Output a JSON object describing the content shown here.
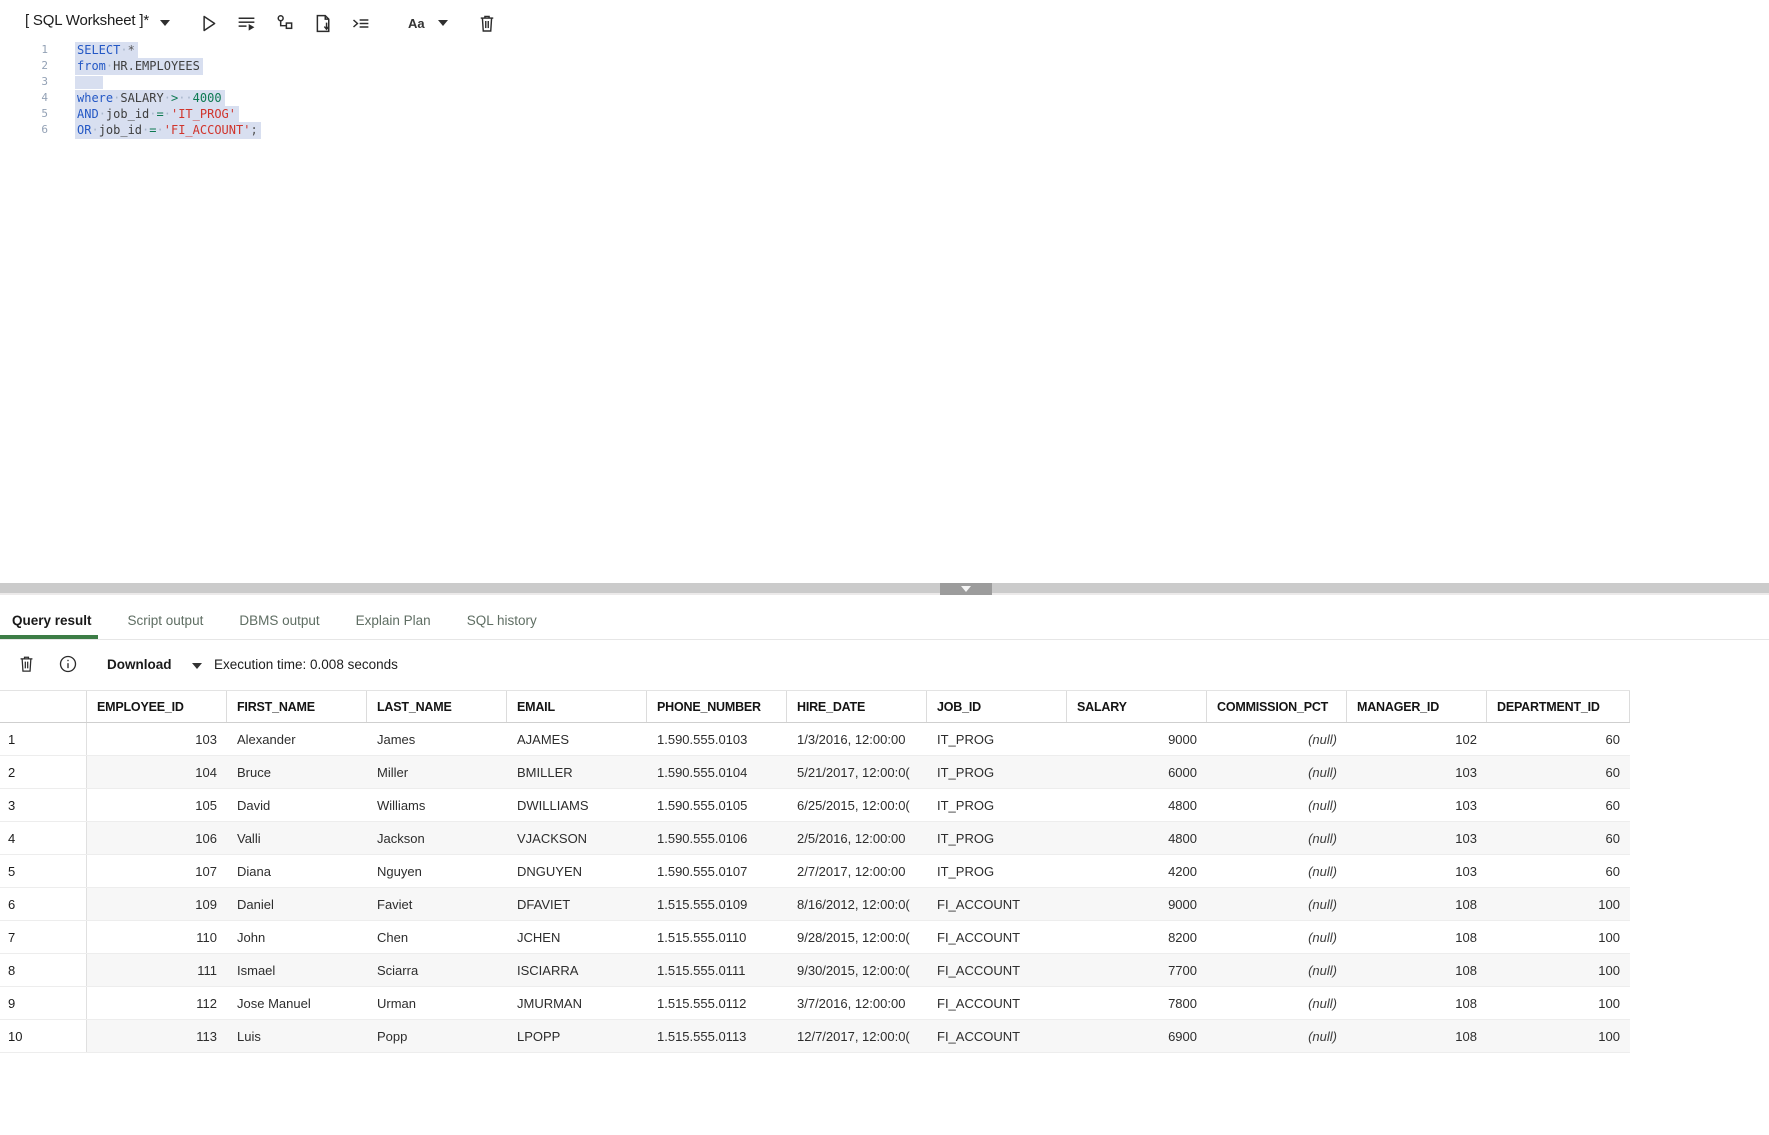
{
  "worksheet": {
    "title": "[ SQL Worksheet ]*",
    "font_button_label": "Aa"
  },
  "editor": {
    "lines": [
      {
        "num": "1",
        "tokens": [
          [
            "kw",
            "SELECT"
          ],
          [
            "ws",
            "·"
          ],
          [
            "pun",
            "*"
          ]
        ]
      },
      {
        "num": "2",
        "tokens": [
          [
            "kw",
            "from"
          ],
          [
            "ws",
            "·"
          ],
          [
            "id",
            "HR"
          ],
          [
            "pun",
            "."
          ],
          [
            "id",
            "EMPLOYEES"
          ]
        ]
      },
      {
        "num": "3",
        "tokens": []
      },
      {
        "num": "4",
        "tokens": [
          [
            "kw",
            "where"
          ],
          [
            "ws",
            "·"
          ],
          [
            "id",
            "SALARY"
          ],
          [
            "ws",
            "·"
          ],
          [
            "op",
            ">"
          ],
          [
            "ws",
            "··"
          ],
          [
            "num",
            "4000"
          ]
        ]
      },
      {
        "num": "5",
        "tokens": [
          [
            "kw",
            "AND"
          ],
          [
            "ws",
            "·"
          ],
          [
            "id",
            "job_id"
          ],
          [
            "ws",
            "·"
          ],
          [
            "op",
            "="
          ],
          [
            "ws",
            "·"
          ],
          [
            "str",
            "'IT_PROG'"
          ]
        ]
      },
      {
        "num": "6",
        "tokens": [
          [
            "kw",
            "OR"
          ],
          [
            "ws",
            "·"
          ],
          [
            "id",
            "job_id"
          ],
          [
            "ws",
            "·"
          ],
          [
            "op",
            "="
          ],
          [
            "ws",
            "·"
          ],
          [
            "str",
            "'FI_ACCOUNT'"
          ],
          [
            "pun",
            ";"
          ]
        ]
      }
    ]
  },
  "tabs": [
    {
      "label": "Query result",
      "active": true
    },
    {
      "label": "Script output",
      "active": false
    },
    {
      "label": "DBMS output",
      "active": false
    },
    {
      "label": "Explain Plan",
      "active": false
    },
    {
      "label": "SQL history",
      "active": false
    }
  ],
  "result_toolbar": {
    "download_label": "Download",
    "execution_time": "Execution time: 0.008 seconds"
  },
  "table": {
    "columns": [
      {
        "label": "EMPLOYEE_ID",
        "align": "right"
      },
      {
        "label": "FIRST_NAME",
        "align": "left"
      },
      {
        "label": "LAST_NAME",
        "align": "left"
      },
      {
        "label": "EMAIL",
        "align": "left"
      },
      {
        "label": "PHONE_NUMBER",
        "align": "left"
      },
      {
        "label": "HIRE_DATE",
        "align": "left"
      },
      {
        "label": "JOB_ID",
        "align": "left"
      },
      {
        "label": "SALARY",
        "align": "right"
      },
      {
        "label": "COMMISSION_PCT",
        "align": "right"
      },
      {
        "label": "MANAGER_ID",
        "align": "right"
      },
      {
        "label": "DEPARTMENT_ID",
        "align": "right"
      }
    ],
    "rows": [
      [
        "1",
        "103",
        "Alexander",
        "James",
        "AJAMES",
        "1.590.555.0103",
        "1/3/2016, 12:00:00",
        "IT_PROG",
        "9000",
        "(null)",
        "102",
        "60"
      ],
      [
        "2",
        "104",
        "Bruce",
        "Miller",
        "BMILLER",
        "1.590.555.0104",
        "5/21/2017, 12:00:0(",
        "IT_PROG",
        "6000",
        "(null)",
        "103",
        "60"
      ],
      [
        "3",
        "105",
        "David",
        "Williams",
        "DWILLIAMS",
        "1.590.555.0105",
        "6/25/2015, 12:00:0(",
        "IT_PROG",
        "4800",
        "(null)",
        "103",
        "60"
      ],
      [
        "4",
        "106",
        "Valli",
        "Jackson",
        "VJACKSON",
        "1.590.555.0106",
        "2/5/2016, 12:00:00",
        "IT_PROG",
        "4800",
        "(null)",
        "103",
        "60"
      ],
      [
        "5",
        "107",
        "Diana",
        "Nguyen",
        "DNGUYEN",
        "1.590.555.0107",
        "2/7/2017, 12:00:00",
        "IT_PROG",
        "4200",
        "(null)",
        "103",
        "60"
      ],
      [
        "6",
        "109",
        "Daniel",
        "Faviet",
        "DFAVIET",
        "1.515.555.0109",
        "8/16/2012, 12:00:0(",
        "FI_ACCOUNT",
        "9000",
        "(null)",
        "108",
        "100"
      ],
      [
        "7",
        "110",
        "John",
        "Chen",
        "JCHEN",
        "1.515.555.0110",
        "9/28/2015, 12:00:0(",
        "FI_ACCOUNT",
        "8200",
        "(null)",
        "108",
        "100"
      ],
      [
        "8",
        "111",
        "Ismael",
        "Sciarra",
        "ISCIARRA",
        "1.515.555.0111",
        "9/30/2015, 12:00:0(",
        "FI_ACCOUNT",
        "7700",
        "(null)",
        "108",
        "100"
      ],
      [
        "9",
        "112",
        "Jose Manuel",
        "Urman",
        "JMURMAN",
        "1.515.555.0112",
        "3/7/2016, 12:00:00",
        "FI_ACCOUNT",
        "7800",
        "(null)",
        "108",
        "100"
      ],
      [
        "10",
        "113",
        "Luis",
        "Popp",
        "LPOPP",
        "1.515.555.0113",
        "12/7/2017, 12:00:0(",
        "FI_ACCOUNT",
        "6900",
        "(null)",
        "108",
        "100"
      ]
    ]
  },
  "colors": {
    "tab_active_underline": "#3c7d46",
    "editor_selection": "#d8dff0",
    "syntax_keyword": "#2458c5",
    "syntax_string": "#d0342c",
    "syntax_number_operator": "#0e7a52",
    "stripe_row": "#f7f7f7",
    "splitter_bar": "#cbcbcb",
    "splitter_handle": "#9c9c9c"
  }
}
